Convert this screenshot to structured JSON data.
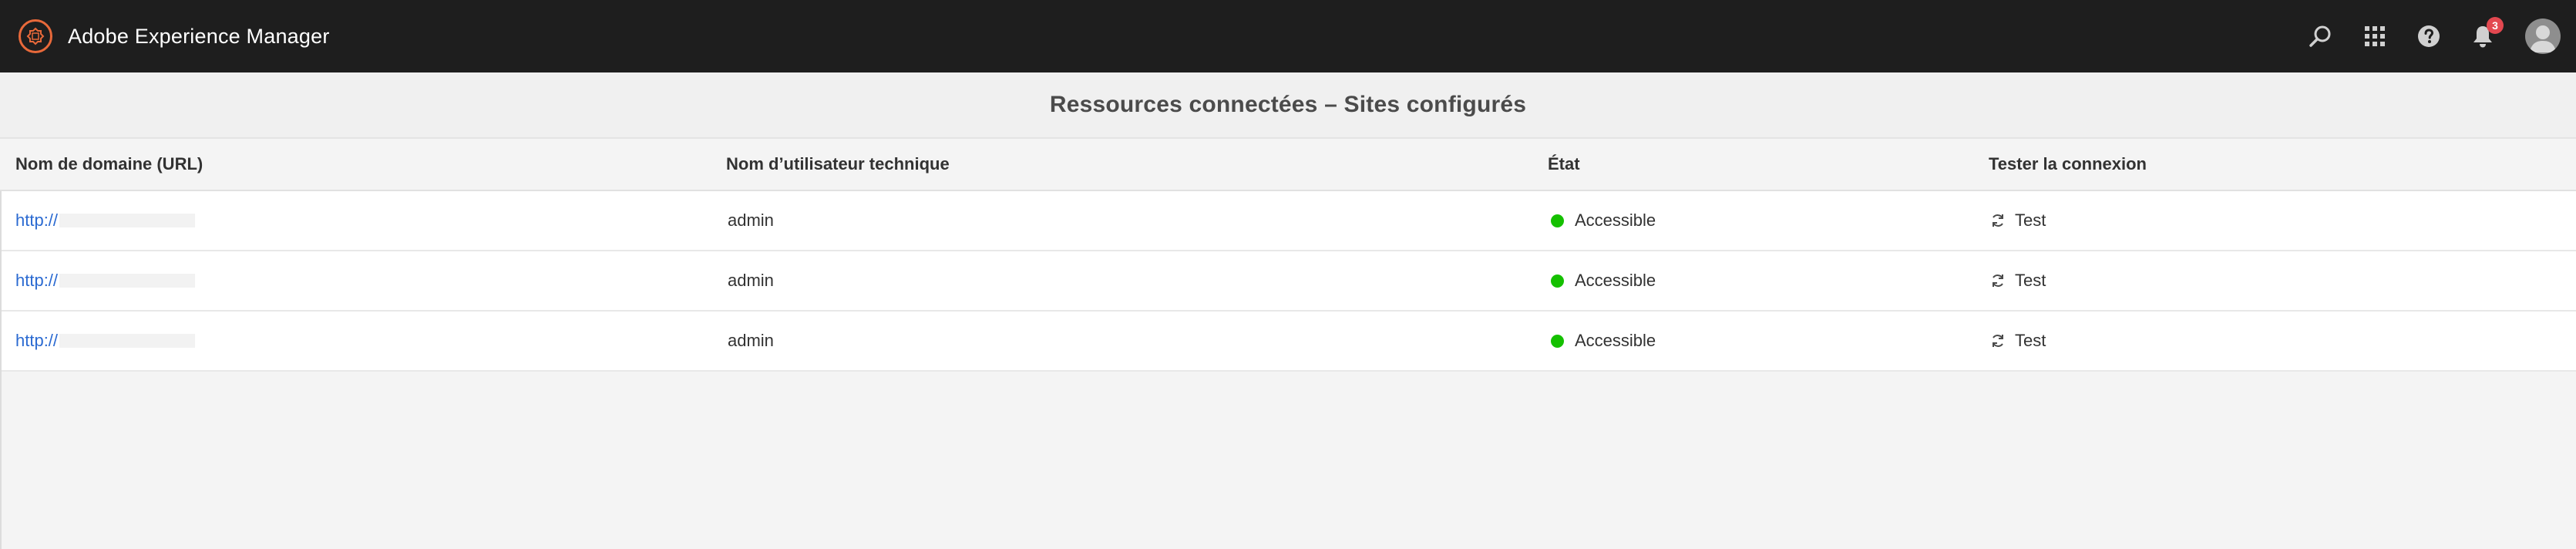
{
  "app": {
    "title": "Adobe Experience Manager",
    "logo_icon": "aem-logo-icon",
    "accent_color": "#e8693a"
  },
  "topbar": {
    "actions": [
      {
        "name": "search-icon"
      },
      {
        "name": "solutions-grid-icon"
      },
      {
        "name": "help-icon"
      },
      {
        "name": "bell-icon",
        "badge": "3"
      },
      {
        "name": "user-avatar"
      }
    ],
    "badge_color": "#e34850"
  },
  "page": {
    "title": "Ressources connectées – Sites configurés"
  },
  "table": {
    "columns": [
      "Nom de domaine (URL)",
      "Nom d’utilisateur technique",
      "État",
      "Tester la connexion"
    ],
    "rows": [
      {
        "url": "http://",
        "user": "admin",
        "status": "Accessible",
        "action": "Test"
      },
      {
        "url": "http://",
        "user": "admin",
        "status": "Accessible",
        "action": "Test"
      },
      {
        "url": "http://",
        "user": "admin",
        "status": "Accessible",
        "action": "Test"
      }
    ],
    "status_color": "#15c000",
    "link_color": "#2b6ad1"
  }
}
